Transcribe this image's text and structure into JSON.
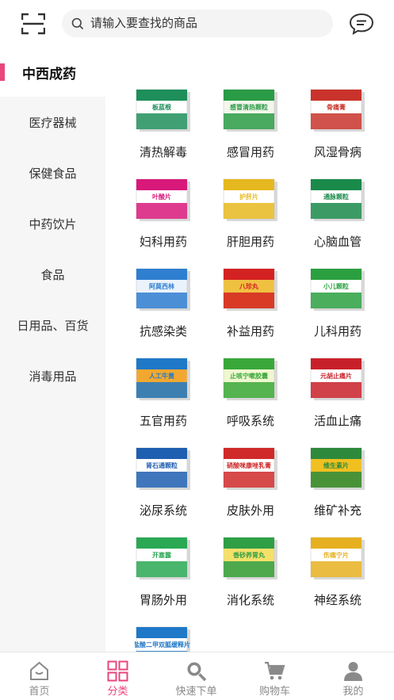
{
  "header": {
    "search_placeholder": "请输入要查找的商品"
  },
  "sidebar": {
    "active": "中西成药",
    "items": [
      {
        "label": "医疗器械"
      },
      {
        "label": "保健食品"
      },
      {
        "label": "中药饮片"
      },
      {
        "label": "食品"
      },
      {
        "label": "日用品、百货"
      },
      {
        "label": "消毒用品"
      }
    ]
  },
  "products": [
    {
      "label": "清热解毒",
      "box": "#1e8f5a",
      "band": "#ffffff",
      "title": "板蓝根"
    },
    {
      "label": "感冒用药",
      "box": "#2a9b46",
      "band": "#f3f6ea",
      "title": "感冒清热颗粒"
    },
    {
      "label": "风湿骨病",
      "box": "#c9332b",
      "band": "#ffffff",
      "title": "骨痛膏"
    },
    {
      "label": "妇科用药",
      "box": "#d8197a",
      "band": "#ffffff",
      "title": "叶酸片"
    },
    {
      "label": "肝胆用药",
      "box": "#e6b81f",
      "band": "#ffffff",
      "title": "护肝片"
    },
    {
      "label": "心脑血管",
      "box": "#1a8a4a",
      "band": "#ffffff",
      "title": "通脉颗粒"
    },
    {
      "label": "抗感染类",
      "box": "#2f7fd0",
      "band": "#eaf2fb",
      "title": "阿莫西林"
    },
    {
      "label": "补益用药",
      "box": "#d42222",
      "band": "#f0c040",
      "title": "八珍丸"
    },
    {
      "label": "儿科用药",
      "box": "#2aa040",
      "band": "#ffffff",
      "title": "小儿颗粒"
    },
    {
      "label": "五官用药",
      "box": "#1f78c8",
      "band": "#f2a830",
      "title": "人工牛黄"
    },
    {
      "label": "呼吸系统",
      "box": "#39a83a",
      "band": "#eef7d0",
      "title": "止咳宁嗽胶囊"
    },
    {
      "label": "活血止痛",
      "box": "#c8202a",
      "band": "#ffffff",
      "title": "元胡止痛片"
    },
    {
      "label": "泌尿系统",
      "box": "#1f5fb0",
      "band": "#ffffff",
      "title": "肾石通颗粒"
    },
    {
      "label": "皮肤外用",
      "box": "#d02a2a",
      "band": "#ffffff",
      "title": "硝酸咪康唑乳膏"
    },
    {
      "label": "维矿补充",
      "box": "#2d8a3c",
      "band": "#f0c020",
      "title": "维生素片"
    },
    {
      "label": "胃肠外用",
      "box": "#2aa854",
      "band": "#ffffff",
      "title": "开塞露"
    },
    {
      "label": "消化系统",
      "box": "#2f9f45",
      "band": "#f5e06a",
      "title": "香砂养胃丸"
    },
    {
      "label": "神经系统",
      "box": "#e6b020",
      "band": "#ffffff",
      "title": "伤痛宁片"
    },
    {
      "label": "",
      "box": "#1f78c8",
      "band": "#ffffff",
      "title": "盐酸二甲双胍缓释片"
    }
  ],
  "tabs": [
    {
      "label": "首页"
    },
    {
      "label": "分类"
    },
    {
      "label": "快速下单"
    },
    {
      "label": "购物车"
    },
    {
      "label": "我的"
    }
  ],
  "colors": {
    "accent": "#e8467c",
    "inactive": "#8a8a8a",
    "sidebar_bg": "#f6f6f6"
  }
}
